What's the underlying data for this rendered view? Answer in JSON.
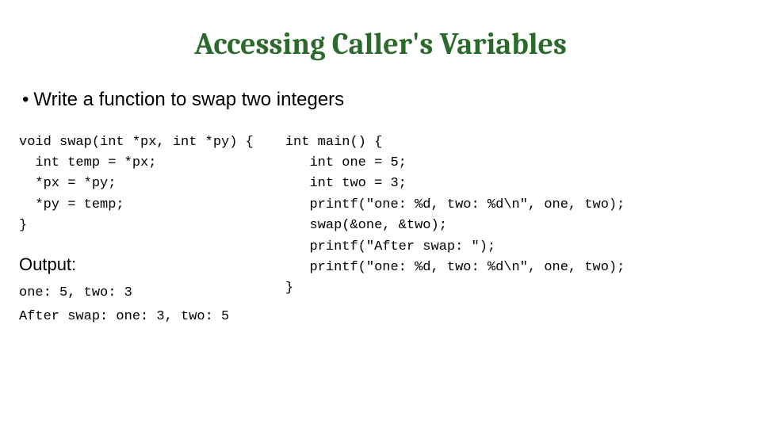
{
  "title": "Accessing Caller's Variables",
  "bullet": "Write a function to swap two integers",
  "code_left": "void swap(int *px, int *py) {\n  int temp = *px;\n  *px = *py;\n  *py = temp;\n}",
  "code_right": "int main() {\n   int one = 5;\n   int two = 3;\n   printf(\"one: %d, two: %d\\n\", one, two);\n   swap(&one, &two);\n   printf(\"After swap: \");\n   printf(\"one: %d, two: %d\\n\", one, two);\n}",
  "output_label": "Output:",
  "output_text": "one: 5, two: 3\nAfter swap: one: 3, two: 5"
}
